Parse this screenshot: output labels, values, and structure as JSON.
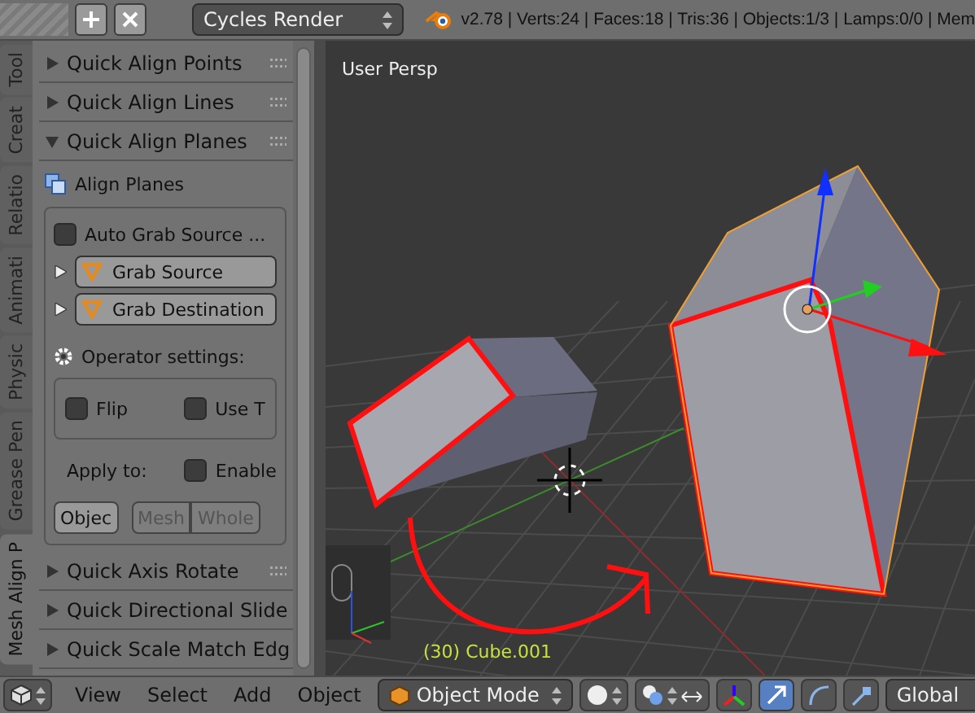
{
  "header": {
    "render_engine": "Cycles Render",
    "stats": "v2.78 | Verts:24 | Faces:18 | Tris:36 | Objects:1/3 | Lamps:0/0 | Mem"
  },
  "tabs": [
    {
      "label": "Tool",
      "selected": false
    },
    {
      "label": "Creat",
      "selected": false
    },
    {
      "label": "Relatio",
      "selected": false
    },
    {
      "label": "Animati",
      "selected": false
    },
    {
      "label": "Physic",
      "selected": false
    },
    {
      "label": "Grease Pen",
      "selected": false
    },
    {
      "label": "Mesh Align P",
      "selected": true
    }
  ],
  "panels": [
    {
      "title": "Quick Align Points",
      "expanded": false
    },
    {
      "title": "Quick Align Lines",
      "expanded": false
    },
    {
      "title": "Quick Align Planes",
      "expanded": true,
      "operator": "Align Planes",
      "auto_grab": {
        "label": "Auto Grab Source ...",
        "checked": false
      },
      "grab_buttons": [
        {
          "label": "Grab Source",
          "expanded": false
        },
        {
          "label": "Grab Destination",
          "expanded": false
        }
      ],
      "settings_label": "Operator settings:",
      "options": [
        {
          "label": "Flip",
          "checked": false
        },
        {
          "label": "Use T",
          "checked": false
        }
      ],
      "apply_label": "Apply to:",
      "enable": {
        "label": "Enable",
        "checked": false
      },
      "targets": [
        {
          "label": "Objec",
          "disabled": false
        },
        {
          "label": "Mesh",
          "disabled": true
        },
        {
          "label": "Whole",
          "disabled": true
        }
      ]
    },
    {
      "title": "Quick Axis Rotate",
      "expanded": false
    },
    {
      "title": "Quick Directional Slide",
      "expanded": false
    },
    {
      "title": "Quick Scale Match Edg",
      "expanded": false
    }
  ],
  "viewport": {
    "view_label": "User Persp",
    "object_label": "(30) Cube.001"
  },
  "bottom_bar": {
    "menus": [
      "View",
      "Select",
      "Add",
      "Object"
    ],
    "mode": "Object Mode",
    "orientation": "Global"
  }
}
